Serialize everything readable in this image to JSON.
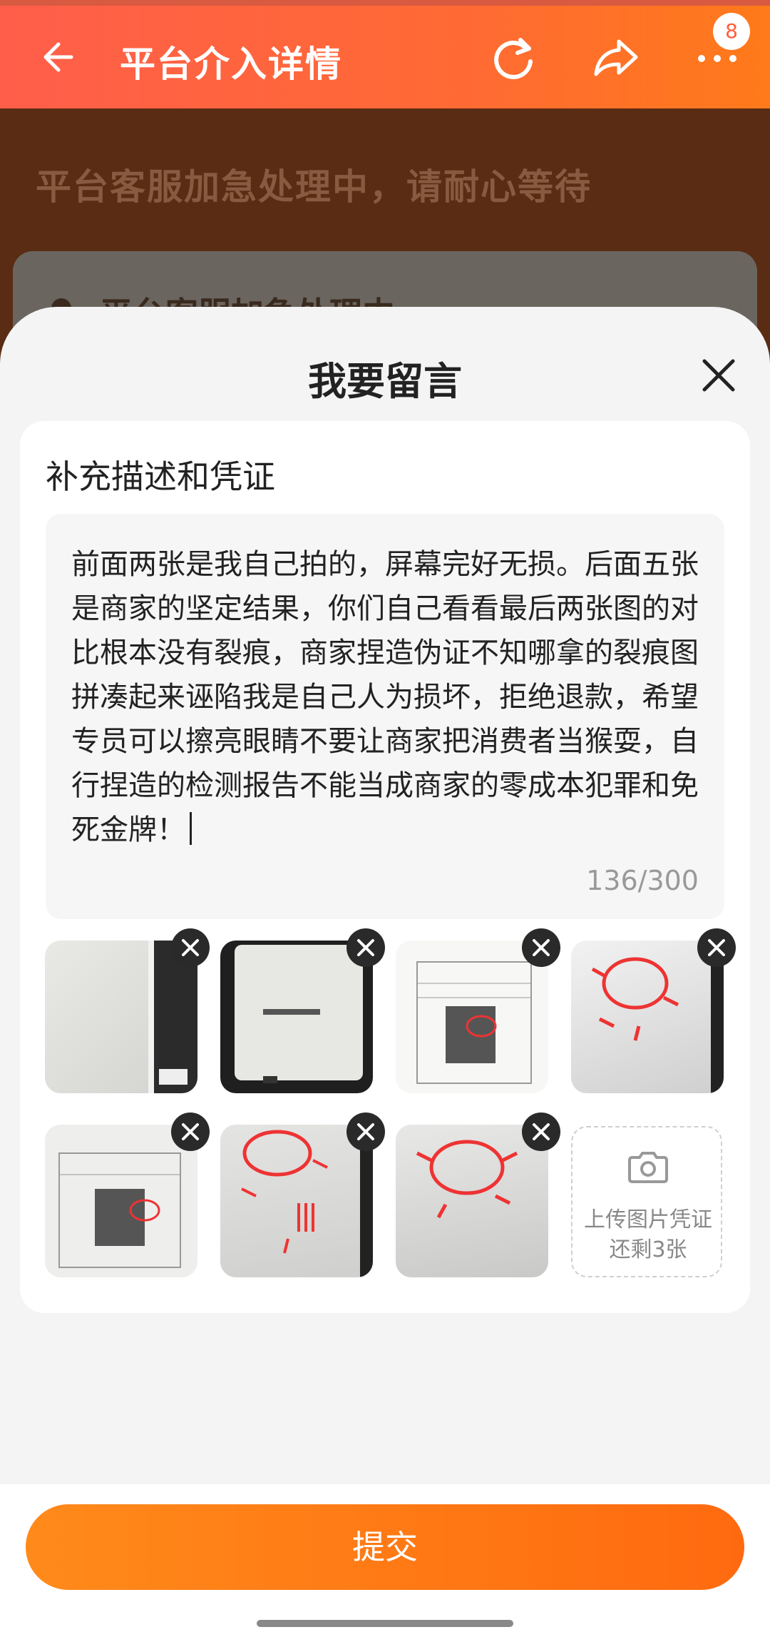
{
  "header": {
    "title": "平台介入详情",
    "badge_count": "8",
    "icons": [
      "back-arrow-icon",
      "refresh-icon",
      "share-icon",
      "more-icon"
    ]
  },
  "background": {
    "status_text": "平台客服加急处理中，请耐心等待",
    "card_text": "平台客服加急处理中"
  },
  "sheet": {
    "title": "我要留言",
    "section_label": "补充描述和凭证",
    "message": "前面两张是我自己拍的，屏幕完好无损。后面五张是商家的坚定结果，你们自己看看最后两张图的对比根本没有裂痕，商家捏造伪证不知哪拿的裂痕图拼凑起来诬陷我是自己人为损坏，拒绝退款，希望专员可以擦亮眼睛不要让商家把消费者当猴耍，自行捏造的检测报告不能当成商家的零成本犯罪和免死金牌！",
    "counter": "136/300",
    "upload": {
      "line1": "上传图片凭证",
      "line2": "还剩3张"
    }
  },
  "footer": {
    "submit_label": "提交"
  },
  "colors": {
    "header_start": "#ff5e4a",
    "header_end": "#ff7a1a",
    "submit": "#ff7a14"
  }
}
